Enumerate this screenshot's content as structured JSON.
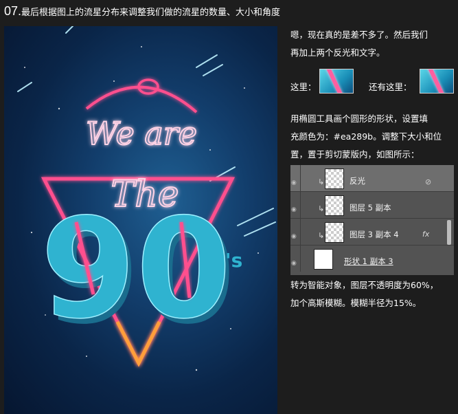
{
  "heading": {
    "num": "07.",
    "text": "最后根据图上的流星分布来调整我们做的流星的数量、大小和角度"
  },
  "poster": {
    "line1": "We are",
    "line2": "The",
    "num": "90",
    "suffix": "'s",
    "colors": {
      "neon": "#ff4f8e",
      "glow": "#ffd3e6",
      "block": "#2fb3d0",
      "triangle_bottom": "#ff9f3a"
    }
  },
  "text": {
    "p1a": "嗯，现在真的是差不多了。然后我们",
    "p1b": "再加上两个反光和文字。",
    "here": "这里：",
    "also": "还有这里：",
    "p2a": "用椭圆工具画个圆形的形状，设置填",
    "p2b": "充颜色为：#ea289b。调整下大小和位",
    "p2c": "置，置于剪切蒙版内，如图所示：",
    "p3a": "转为智能对象，图层不透明度为60%，",
    "p3b": "加个高斯模糊。模糊半径为15%。"
  },
  "layers": [
    {
      "name": "反光",
      "selected": true
    },
    {
      "name": "图层 5 副本",
      "selected": false
    },
    {
      "name": "图层 3 副本 4",
      "selected": false,
      "fx": "fx"
    },
    {
      "name": "形状 1 副本 3",
      "selected": false
    }
  ]
}
